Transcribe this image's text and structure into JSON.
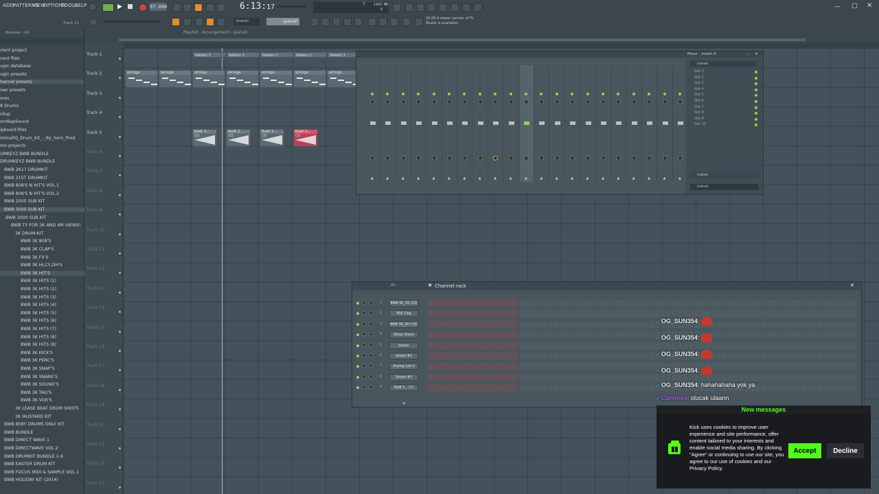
{
  "menu": [
    "ADD",
    "PATTERNS",
    "VIEW",
    "OPTIONS",
    "TOOLS",
    "HELP"
  ],
  "toolbar": {
    "tempo": "97.000",
    "time": "6:13",
    "time_sub": "17",
    "cpu_value": "7",
    "memory": "1433 MB",
    "memory_sub": "0",
    "pattern_select": "(none)",
    "snap": "pianoll",
    "hint_line1": "20.08  A newer version of FL",
    "hint_line2": "Studio is available!",
    "track_label": "Track 21"
  },
  "playlist": {
    "title": "Playlist - Arrangement › pianoll",
    "tracks": [
      "Track 1",
      "Track 2",
      "Track 3",
      "Track 4",
      "Track 5",
      "Track 6",
      "Track 7",
      "Track 8",
      "Track 9",
      "Track 10",
      "Track 11",
      "Track 12",
      "Track 13",
      "Track 14",
      "Track 15",
      "Track 16",
      "Track 17",
      "Track 18",
      "Track 19",
      "Track 20",
      "Track 21",
      "Track 22",
      "Track 23"
    ],
    "pattern_clips": [
      "Pattern 1",
      "Pattern 1",
      "Pattern 1",
      "Pattern 1",
      "Pattern 1"
    ],
    "string_clips": [
      "strings",
      "strings",
      "strings",
      "strings",
      "strings",
      "strings",
      "strings"
    ],
    "audio_clips": [
      "BwB 3... (1)",
      "BwB 3... (1)",
      "BwB 3... (1)",
      "BwB 3... (1)"
    ]
  },
  "browser": {
    "title": "Browser - All",
    "items": [
      "rrent project",
      "cent files",
      "ugin database",
      "ugin presets",
      "hannel presets",
      "ixer presets",
      "ores",
      "8 Drums",
      "ckup",
      "omBapSound",
      "ipboard files",
      "iminalIQ_Drum_Kit_-_By_Sero_Prod",
      "mo projects",
      "UMKEYZ BWB BUNDLE",
      "DRUMKEYZ BWB BUNDLE",
      "BWB 2K17 DRUMKIT",
      "BWB 21ST DRUMKIT",
      "BWB 808'S N HIT'S VOL.1",
      "BWB 808'S N HIT'S VOL.2",
      "BWB 2000 SUB KIT",
      "BWB 3000 SUB KIT",
      "BWB 3000 SUB KIT",
      "BWB TY FOR 3K AND 4M VIEWS!",
      "3K DRUM-KIT",
      "BWB 3K 808'S",
      "BWB 3K CLAP'S",
      "BWB 3K FX'S",
      "BWB 3K HI,CY,OH'S",
      "BWB 3K HIT'S",
      "BWB 3K HITS (1)",
      "BWB 3K HITS (2)",
      "BWB 3K HITS (3)",
      "BWB 3K HITS (4)",
      "BWB 3K HITS (5)",
      "BWB 3K HITS (6)",
      "BWB 3K HITS (7)",
      "BWB 3K HITS (8)",
      "BWB 3K HITS (9)",
      "BWB 3K KICK'S",
      "BWB 3K PERC'S",
      "BWB 3K SNAP'S",
      "BWB 3K SNARE'S",
      "BWB 3K SOUND'S",
      "BWB 3K TAG'S",
      "BWB 3K VOX'S",
      "3K LEASE BEAT DRUM SHOTS",
      "3K MUSTARD KIT",
      "BWB 808Y DRUMS ONLY KIT",
      "BWB BUNDLE",
      "BWB DIRECT WAVE 1",
      "BWB DIRECTWAVE VOL.2",
      "BWB DRUMKIT BUNDLE 1-6",
      "BWB EASTER DRUM KIT",
      "BWB FOCUS MIDI & SAMPLE VOL.1",
      "BWB HOLIDAY KIT (2014)"
    ]
  },
  "mixer": {
    "title": "Mixer - Insert 9",
    "slots": [
      "Slot 1",
      "Slot 2",
      "Slot 3",
      "Slot 4",
      "Slot 5",
      "Slot 6",
      "Slot 7",
      "Slot 8",
      "Slot 9",
      "Slot 10"
    ],
    "route_none1": "(none)",
    "route_none2": "(none)",
    "header_select": "(none)"
  },
  "channel_rack": {
    "title": "Channel rack",
    "filter": "All",
    "channels": [
      {
        "num": "1",
        "name": "BWB 3K_CR (20)"
      },
      {
        "num": "2",
        "name": "808 Clap"
      },
      {
        "num": "3",
        "name": "BWB 3K_OH (16)"
      },
      {
        "num": "4",
        "name": "Delay Snare"
      },
      {
        "num": "5",
        "name": "Sinwix"
      },
      {
        "num": "6",
        "name": "Sinwix #2"
      },
      {
        "num": "7",
        "name": "Analog Lab V"
      },
      {
        "num": "8",
        "name": "Sinwix #3"
      },
      {
        "num": "9",
        "name": "BwB 3... (1)"
      }
    ]
  },
  "chat": {
    "lines": [
      {
        "user": "OG_SUN354",
        "text": ":",
        "emote": true
      },
      {
        "user": "OG_SUN354",
        "text": ":",
        "emote": true
      },
      {
        "user": "OG_SUN354",
        "text": ":",
        "emote": true
      },
      {
        "user": "OG_SUN354",
        "text": ":",
        "emote": true
      },
      {
        "user": "OG_SUN354",
        "text": ": hahahahaha yok ya",
        "emote": false
      },
      {
        "user": "Canonex",
        "text": ": olucak ulaann",
        "emote": false
      }
    ],
    "new_messages": "New messages"
  },
  "cookie": {
    "text": "Kick uses cookies to improve user experience and site performance, offer content tailored to your interests and enable social media sharing. By clicking \"Agree\" or continuing to use our site, you agree to our use of cookies and our Privacy Policy.",
    "accept": "Accept",
    "decline": "Decline",
    "accent_color": "#53fc18"
  }
}
